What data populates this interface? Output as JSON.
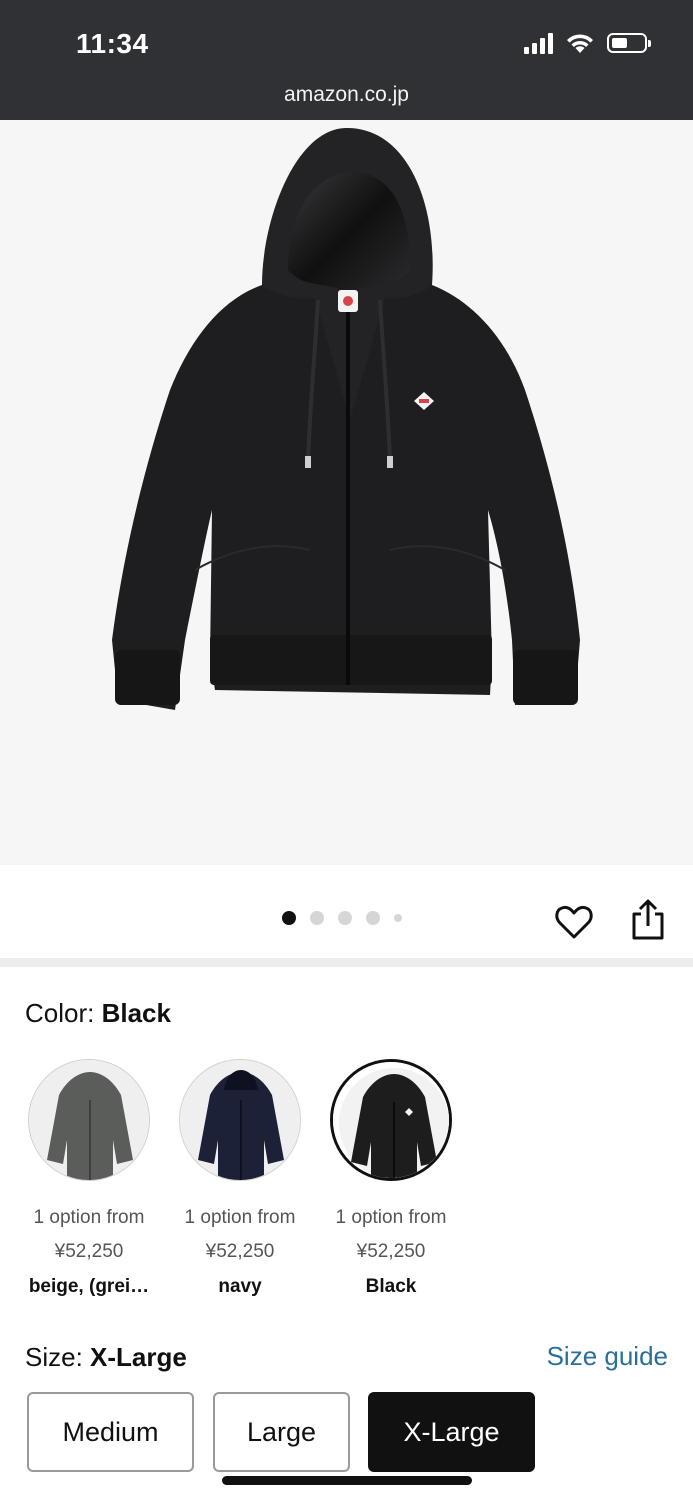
{
  "status_bar": {
    "time": "11:34",
    "url": "amazon.co.jp",
    "battery_level": 0.5
  },
  "gallery": {
    "image_label": "black hooded zip jacket",
    "dot_count": 5,
    "active_dot": 0
  },
  "color": {
    "label": "Color: ",
    "selected": "Black",
    "options": [
      {
        "availability": "1 option from",
        "price": "¥52,250",
        "name": "beige, (grei…",
        "swatch_color": "#5b5d5a"
      },
      {
        "availability": "1 option from",
        "price": "¥52,250",
        "name": "navy",
        "swatch_color": "#1c2138"
      },
      {
        "availability": "1 option from",
        "price": "¥52,250",
        "name": "Black",
        "swatch_color": "#1d1d1e"
      }
    ]
  },
  "size": {
    "label": "Size: ",
    "selected": "X-Large",
    "guide_link": "Size guide",
    "options": [
      "Medium",
      "Large",
      "X-Large"
    ]
  },
  "colors": {
    "status_bar_bg": "#2f3134",
    "link": "#2a6f97",
    "selected_size_bg": "#111111"
  }
}
